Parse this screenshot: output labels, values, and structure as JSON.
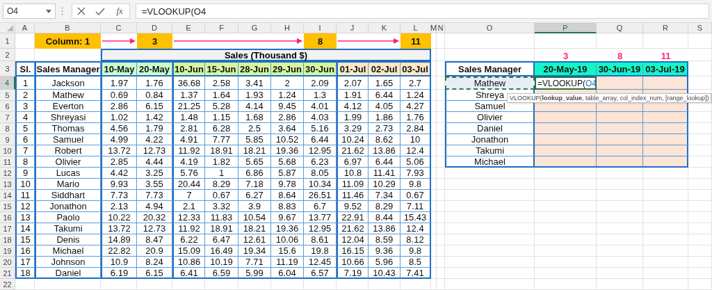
{
  "name_box": {
    "value": "O4"
  },
  "formula_bar": {
    "insert_function": "fx",
    "value": "=VLOOKUP(O4"
  },
  "column_headers": [
    {
      "label": "A",
      "selected": false
    },
    {
      "label": "B",
      "selected": false
    },
    {
      "label": "C",
      "selected": false
    },
    {
      "label": "D",
      "selected": false
    },
    {
      "label": "E",
      "selected": false
    },
    {
      "label": "F",
      "selected": false
    },
    {
      "label": "G",
      "selected": false
    },
    {
      "label": "H",
      "selected": false
    },
    {
      "label": "I",
      "selected": false
    },
    {
      "label": "J",
      "selected": false
    },
    {
      "label": "K",
      "selected": false
    },
    {
      "label": "L",
      "selected": false
    },
    {
      "label": "M",
      "selected": false
    },
    {
      "label": "N",
      "selected": false
    },
    {
      "label": "O",
      "selected": false
    },
    {
      "label": "P",
      "selected": true
    },
    {
      "label": "Q",
      "selected": false
    },
    {
      "label": "R",
      "selected": false
    },
    {
      "label": "S",
      "selected": false
    }
  ],
  "row_headers": [
    {
      "label": "1",
      "selected": false
    },
    {
      "label": "2",
      "selected": false
    },
    {
      "label": "3",
      "selected": false
    },
    {
      "label": "4",
      "selected": true
    },
    {
      "label": "5",
      "selected": false
    },
    {
      "label": "6",
      "selected": false
    },
    {
      "label": "7",
      "selected": false
    },
    {
      "label": "8",
      "selected": false
    },
    {
      "label": "9",
      "selected": false
    },
    {
      "label": "10",
      "selected": false
    },
    {
      "label": "11",
      "selected": false
    },
    {
      "label": "12",
      "selected": false
    },
    {
      "label": "13",
      "selected": false
    },
    {
      "label": "14",
      "selected": false
    },
    {
      "label": "15",
      "selected": false
    },
    {
      "label": "16",
      "selected": false
    },
    {
      "label": "17",
      "selected": false
    },
    {
      "label": "18",
      "selected": false
    },
    {
      "label": "19",
      "selected": false
    },
    {
      "label": "20",
      "selected": false
    },
    {
      "label": "21",
      "selected": false
    },
    {
      "label": "22",
      "selected": false
    }
  ],
  "column_guide": {
    "label": "Column: 1",
    "markers": [
      "3",
      "8",
      "11"
    ]
  },
  "sales_table": {
    "title": "Sales (Thousand $)",
    "columns": [
      {
        "label": "Sl."
      },
      {
        "label": "Sales Manager"
      },
      {
        "label": "10-May",
        "color": "#ccffcc"
      },
      {
        "label": "20-May",
        "color": "#ccffcc"
      },
      {
        "label": "10-Jun",
        "color": "#d6f7a0"
      },
      {
        "label": "15-Jun",
        "color": "#d6f7a0"
      },
      {
        "label": "28-Jun",
        "color": "#d6f7a0"
      },
      {
        "label": "29-Jun",
        "color": "#d6f7a0"
      },
      {
        "label": "30-Jun",
        "color": "#d6f7a0"
      },
      {
        "label": "01-Jul",
        "color": "#fde9c6"
      },
      {
        "label": "02-Jul",
        "color": "#fde9c6"
      },
      {
        "label": "03-Jul",
        "color": "#fde9c6"
      }
    ],
    "rows": [
      [
        "1",
        "Jackson",
        "1.97",
        "1.76",
        "36.68",
        "2.58",
        "3.41",
        "2",
        "2.09",
        "2.07",
        "1.65",
        "2.7"
      ],
      [
        "2",
        "Mathew",
        "0.69",
        "0.84",
        "1.37",
        "1.64",
        "1.93",
        "1.24",
        "1.3",
        "1.91",
        "6.44",
        "1.24"
      ],
      [
        "3",
        "Everton",
        "2.86",
        "6.15",
        "21.25",
        "5.28",
        "4.14",
        "9.45",
        "4.01",
        "4.12",
        "4.05",
        "4.27"
      ],
      [
        "4",
        "Shreyasi",
        "1.02",
        "1.42",
        "1.48",
        "1.15",
        "1.68",
        "2.86",
        "4.03",
        "1.99",
        "1.86",
        "1.76"
      ],
      [
        "5",
        "Thomas",
        "4.56",
        "1.79",
        "2.81",
        "6.28",
        "2.5",
        "3.64",
        "5.16",
        "3.29",
        "2.73",
        "2.84"
      ],
      [
        "6",
        "Samuel",
        "4.99",
        "4.22",
        "4.91",
        "7.77",
        "5.85",
        "10.52",
        "6.44",
        "10.24",
        "8.62",
        "10"
      ],
      [
        "7",
        "Robert",
        "13.72",
        "12.73",
        "11.92",
        "18.91",
        "18.21",
        "19.36",
        "12.95",
        "21.62",
        "13.86",
        "12.4"
      ],
      [
        "8",
        "Olivier",
        "2.85",
        "4.44",
        "4.19",
        "1.82",
        "5.65",
        "5.68",
        "6.23",
        "6.97",
        "6.44",
        "5.06"
      ],
      [
        "9",
        "Lucas",
        "4.42",
        "3.25",
        "5.76",
        "1",
        "6.86",
        "5.87",
        "8.05",
        "10.8",
        "11.41",
        "7.93"
      ],
      [
        "10",
        "Mario",
        "9.93",
        "3.55",
        "20.44",
        "8.29",
        "7.18",
        "9.78",
        "10.34",
        "11.09",
        "10.29",
        "9.8"
      ],
      [
        "11",
        "Siddhart",
        "7.73",
        "7.73",
        "7",
        "0.67",
        "6.27",
        "8.64",
        "26.51",
        "11.46",
        "7.34",
        "0.67"
      ],
      [
        "12",
        "Jonathon",
        "2.13",
        "4.94",
        "2.1",
        "3.32",
        "3.9",
        "8.83",
        "6.7",
        "9.52",
        "8.29",
        "7.11"
      ],
      [
        "13",
        "Paolo",
        "10.22",
        "20.32",
        "12.33",
        "11.83",
        "10.54",
        "9.67",
        "13.77",
        "22.91",
        "8.44",
        "15.43"
      ],
      [
        "14",
        "Takumi",
        "13.72",
        "12.73",
        "11.92",
        "18.91",
        "18.21",
        "19.36",
        "12.95",
        "21.62",
        "13.86",
        "12.4"
      ],
      [
        "15",
        "Denis",
        "14.89",
        "8.47",
        "6.22",
        "6.47",
        "12.61",
        "10.06",
        "8.61",
        "12.04",
        "8.59",
        "8.12"
      ],
      [
        "16",
        "Michael",
        "22.82",
        "20.9",
        "15.09",
        "16.49",
        "19.34",
        "15.6",
        "19.8",
        "16.15",
        "9.36",
        "9.8"
      ],
      [
        "17",
        "Johnson",
        "10.9",
        "8.24",
        "10.86",
        "10.19",
        "7.71",
        "11.19",
        "12.45",
        "10.66",
        "5.96",
        "8.5"
      ],
      [
        "18",
        "Daniel",
        "6.19",
        "6.15",
        "6.41",
        "6.59",
        "5.99",
        "6.04",
        "6.57",
        "7.19",
        "10.43",
        "7.41"
      ]
    ]
  },
  "lookup_table": {
    "index_labels": [
      "3",
      "8",
      "11"
    ],
    "columns": [
      "Sales Manager",
      "20-May-19",
      "30-Jun-19",
      "03-Jul-19"
    ],
    "rows": [
      {
        "name": "Mathew",
        "referenced": true
      },
      {
        "name": "Shreya",
        "referenced": false
      },
      {
        "name": "Samuel",
        "referenced": false
      },
      {
        "name": "Olivier",
        "referenced": false
      },
      {
        "name": "Daniel",
        "referenced": false
      },
      {
        "name": "Jonathon",
        "referenced": false
      },
      {
        "name": "Takumi",
        "referenced": false
      },
      {
        "name": "Michael",
        "referenced": false
      }
    ]
  },
  "active_cell": {
    "formula": "=VLOOKUP(",
    "reference": "O4"
  },
  "tooltip": "VLOOKUP(**lookup_value**, table_array, col_index_num, [range_lookup])"
}
